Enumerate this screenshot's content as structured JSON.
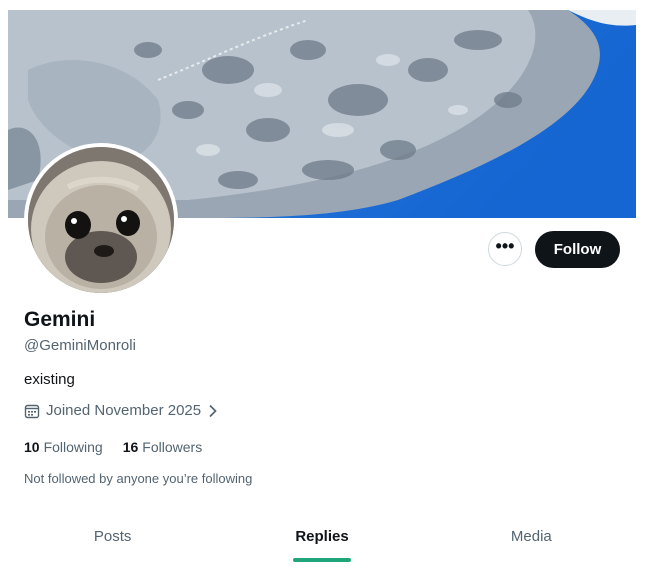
{
  "profile": {
    "name": "Gemini",
    "handle": "@GeminiMonroli",
    "bio": "existing",
    "joined": "Joined November 2025",
    "following_count": "10",
    "following_label": "Following",
    "followers_count": "16",
    "followers_label": "Followers",
    "not_followed_text": "Not followed by anyone you’re following"
  },
  "actions": {
    "more_label": "•••",
    "follow_label": "Follow"
  },
  "tabs": [
    {
      "label": "Posts",
      "active": false
    },
    {
      "label": "Replies",
      "active": true
    },
    {
      "label": "Media",
      "active": false
    }
  ],
  "colors": {
    "primary_text": "#0f1419",
    "secondary_text": "#536471",
    "follow_button_bg": "#0f1419",
    "active_tab_indicator": "#1fa67a",
    "banner_blue": "#1f6ed6"
  },
  "icons": {
    "joined": "calendar-icon",
    "joined_arrow": "chevron-right-icon",
    "more": "more-horizontal-icon"
  }
}
